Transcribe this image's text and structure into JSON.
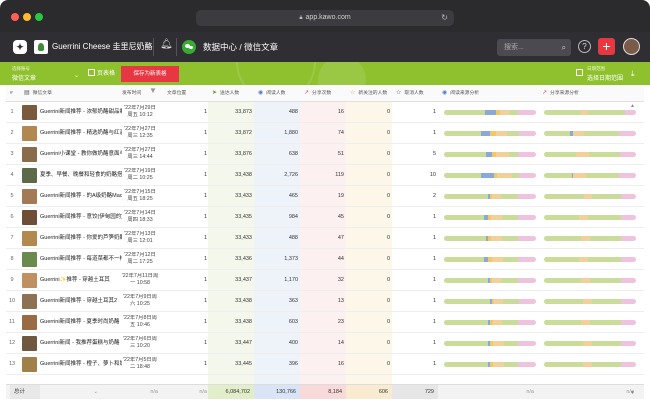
{
  "browser": {
    "url": "app.kawo.com"
  },
  "topbar": {
    "account_name": "Guerrini Cheese 圭里尼奶酪",
    "section_title": "数据中心 / 微信文章",
    "search_placeholder": "搜索...",
    "help": "?",
    "add": "+"
  },
  "filterbar": {
    "content_type_label": "选择账号",
    "content_type_value": "微信文章",
    "template_button": "页表格",
    "save_button": "保存为新表格",
    "date_label": "日期范围",
    "date_value": "选择日期范围"
  },
  "table": {
    "headers": {
      "idx": "#",
      "title": "微信文章",
      "time": "发布时间",
      "position": "文章位置",
      "delivered": "送达人数",
      "readers": "阅读人数",
      "shares": "分享次数",
      "fans": "新关注的人数",
      "unfollows": "取消人数",
      "read_source": "阅读来源分析",
      "share_source": "分享来源分析"
    },
    "rows": [
      {
        "idx": "1",
        "title": "Guerrini新闻推荐 - 浓郁奶酪甜品制",
        "date": "'22年7月29日",
        "day": "周五 10:12",
        "pos": "1",
        "delivered": "33,873",
        "readers": "488",
        "shares": "16",
        "fans": "0",
        "unf": "1",
        "thumb": "#7a5a3c",
        "rb": [
          45,
          12,
          4,
          10,
          10,
          19
        ],
        "sb": [
          40,
          0,
          0,
          8,
          40,
          12
        ]
      },
      {
        "idx": "2",
        "title": "Guerrini新闻推荐 - 精选奶酪与红酒",
        "date": "'22年7月27日",
        "day": "周三 12:35",
        "pos": "1",
        "delivered": "33,872",
        "readers": "1,880",
        "shares": "74",
        "fans": "0",
        "unf": "1",
        "thumb": "#b28850",
        "rb": [
          40,
          10,
          6,
          12,
          14,
          18
        ],
        "sb": [
          28,
          4,
          0,
          12,
          38,
          18
        ]
      },
      {
        "idx": "3",
        "title": "Guerrini小课堂 - 教你做奶酪意面与",
        "date": "'22年7月27日",
        "day": "周三 14:44",
        "pos": "1",
        "delivered": "33,876",
        "readers": "638",
        "shares": "51",
        "fans": "0",
        "unf": "5",
        "thumb": "#8a6b4a",
        "rb": [
          46,
          6,
          5,
          14,
          10,
          19
        ],
        "sb": [
          35,
          0,
          0,
          14,
          34,
          17
        ]
      },
      {
        "idx": "4",
        "title": "夏季、早餐、晚餐和轻食的奶酪搭配",
        "date": "'22年7月19日",
        "day": "周二 10:25",
        "pos": "1",
        "delivered": "33,438",
        "readers": "2,726",
        "shares": "119",
        "fans": "0",
        "unf": "10",
        "thumb": "#5d6a4a",
        "rb": [
          40,
          14,
          4,
          16,
          8,
          18
        ],
        "sb": [
          30,
          2,
          0,
          14,
          36,
          18
        ]
      },
      {
        "idx": "5",
        "title": "Guerrini新闻推荐 - 的A级奶酪Mac",
        "date": "'22年7月15日",
        "day": "周五 18:25",
        "pos": "1",
        "delivered": "33,433",
        "readers": "465",
        "shares": "19",
        "fans": "0",
        "unf": "2",
        "thumb": "#a27a56",
        "rb": [
          48,
          2,
          2,
          10,
          18,
          20
        ],
        "sb": [
          44,
          0,
          0,
          8,
          32,
          16
        ]
      },
      {
        "idx": "6",
        "title": "Guerrini新闻推荐 - 意饺(伊甸园的)",
        "date": "'22年7月14日",
        "day": "周四 18:33",
        "pos": "1",
        "delivered": "33,435",
        "readers": "984",
        "shares": "45",
        "fans": "0",
        "unf": "1",
        "thumb": "#6f4e37",
        "rb": [
          44,
          4,
          3,
          12,
          18,
          19
        ],
        "sb": [
          38,
          0,
          0,
          10,
          36,
          16
        ]
      },
      {
        "idx": "7",
        "title": "Guerrini新闻推荐 - 你爱的芦笋奶酪",
        "date": "'22年7月13日",
        "day": "周三 12:01",
        "pos": "1",
        "delivered": "33,433",
        "readers": "488",
        "shares": "47",
        "fans": "0",
        "unf": "1",
        "thumb": "#b3894d",
        "rb": [
          46,
          2,
          3,
          12,
          18,
          19
        ],
        "sb": [
          40,
          0,
          0,
          10,
          34,
          16
        ]
      },
      {
        "idx": "8",
        "title": "Guerrini新闻推荐 - 每道菜都不一样",
        "date": "'22年7月12日",
        "day": "周二 17:25",
        "pos": "1",
        "delivered": "33,436",
        "readers": "1,373",
        "shares": "44",
        "fans": "0",
        "unf": "1",
        "thumb": "#6b8a4e",
        "rb": [
          44,
          4,
          4,
          12,
          16,
          20
        ],
        "sb": [
          38,
          0,
          0,
          10,
          36,
          16
        ]
      },
      {
        "idx": "9",
        "title": "Guerrini✨推荐 - 穿越土耳其",
        "date": "'22年7月11日周",
        "day": "一 10:58",
        "pos": "1",
        "delivered": "33,437",
        "readers": "1,170",
        "shares": "32",
        "fans": "0",
        "unf": "1",
        "thumb": "#c09060",
        "rb": [
          48,
          2,
          2,
          10,
          18,
          20
        ],
        "sb": [
          40,
          0,
          0,
          10,
          34,
          16
        ]
      },
      {
        "idx": "10",
        "title": "Guerrini新闻推荐 - 穿越土耳其2",
        "date": "'22年7月9日周",
        "day": "六 10:25",
        "pos": "1",
        "delivered": "33,438",
        "readers": "363",
        "shares": "13",
        "fans": "0",
        "unf": "1",
        "thumb": "#8c7252",
        "rb": [
          50,
          2,
          2,
          10,
          18,
          18
        ],
        "sb": [
          42,
          0,
          0,
          10,
          32,
          16
        ]
      },
      {
        "idx": "11",
        "title": "Guerrini新闻推荐 - 夏季时尚奶酪",
        "date": "'22年7月8日周",
        "day": "五 10:46",
        "pos": "1",
        "delivered": "33,438",
        "readers": "603",
        "shares": "23",
        "fans": "0",
        "unf": "1",
        "thumb": "#9a6a44",
        "rb": [
          48,
          2,
          3,
          10,
          17,
          20
        ],
        "sb": [
          40,
          0,
          0,
          10,
          34,
          16
        ]
      },
      {
        "idx": "12",
        "title": "Guerrini新闻 - 我推荐蛋糕与奶酪",
        "date": "'22年7月6日周",
        "day": "三 10:20",
        "pos": "1",
        "delivered": "33,447",
        "readers": "400",
        "shares": "14",
        "fans": "0",
        "unf": "1",
        "thumb": "#705840",
        "rb": [
          48,
          2,
          3,
          12,
          15,
          20
        ],
        "sb": [
          42,
          0,
          0,
          10,
          32,
          16
        ]
      },
      {
        "idx": "13",
        "title": "Guerrini新闻推荐 - 橙子、萝卜和奶",
        "date": "'22年7月5日周",
        "day": "二 18:48",
        "pos": "1",
        "delivered": "33,445",
        "readers": "396",
        "shares": "16",
        "fans": "0",
        "unf": "1",
        "thumb": "#a08048",
        "rb": [
          48,
          2,
          3,
          12,
          15,
          20
        ],
        "sb": [
          42,
          0,
          0,
          10,
          32,
          16
        ]
      }
    ],
    "totals": {
      "label": "总计",
      "time": "n/a",
      "pos": "n/a",
      "delivered": "6,084,702",
      "readers": "130,766",
      "shares": "8,184",
      "fans": "606",
      "unf": "729",
      "read_source": "n/a",
      "share_source": "n/a"
    }
  },
  "colors": {
    "accent_red": "#e63743",
    "brand_green": "#8fc12f",
    "bar_green": "#c9dc9a",
    "bar_blue": "#8aa8d8",
    "bar_yellow": "#f1c76a",
    "bar_orange": "#f3cf9a",
    "bar_pink": "#efc3dd"
  }
}
